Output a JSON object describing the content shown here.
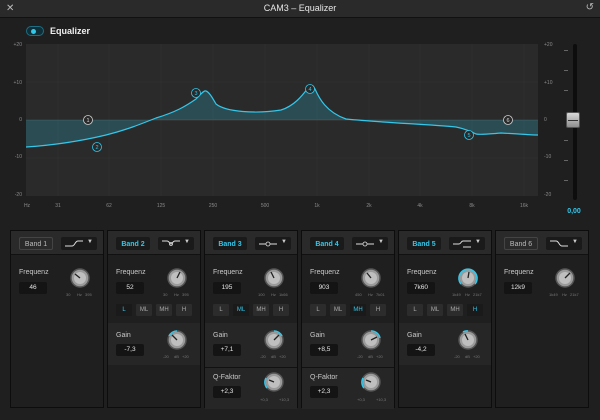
{
  "window": {
    "title": "CAM3 – Equalizer",
    "close_icon": "close-icon",
    "reset_icon": "reset-icon"
  },
  "equalizer": {
    "label": "Equalizer",
    "enabled": true,
    "accent": "#33c7ea"
  },
  "graph": {
    "y_ticks": [
      "+20",
      "+10",
      "0",
      "-10",
      "-20"
    ],
    "x_ticks": [
      "Hz",
      "31",
      "62",
      "125",
      "250",
      "500",
      "1k",
      "2k",
      "4k",
      "8k",
      "16k"
    ]
  },
  "output": {
    "gain_value": "0,00",
    "fader_ticks": [
      "",
      "",
      "",
      "",
      "",
      "",
      "",
      "",
      ""
    ]
  },
  "bands": [
    {
      "name": "Band 1",
      "active": false,
      "shape": "low-shelf",
      "frequency": {
        "label": "Frequenz",
        "value": "46",
        "min": "30",
        "mid": "Hz",
        "max": "395"
      }
    },
    {
      "name": "Band 2",
      "active": true,
      "shape": "bell-low",
      "frequency": {
        "label": "Frequenz",
        "value": "52",
        "min": "30",
        "mid": "Hz",
        "max": "395"
      },
      "ranges": [
        "L",
        "ML",
        "MH",
        "H"
      ],
      "selected_range": "L",
      "gain": {
        "label": "Gain",
        "value": "-7,3",
        "min": "-20",
        "mid": "dB",
        "max": "+20"
      }
    },
    {
      "name": "Band 3",
      "active": true,
      "shape": "bell",
      "frequency": {
        "label": "Frequenz",
        "value": "195",
        "min": "100",
        "mid": "Hz",
        "max": "1k66"
      },
      "ranges": [
        "L",
        "ML",
        "MH",
        "H"
      ],
      "selected_range": "ML",
      "gain": {
        "label": "Gain",
        "value": "+7,1",
        "min": "-20",
        "mid": "dB",
        "max": "+20"
      },
      "q": {
        "label": "Q-Faktor",
        "value": "+2,3",
        "min": "+0,3",
        "mid": "",
        "max": "+10,3"
      }
    },
    {
      "name": "Band 4",
      "active": true,
      "shape": "bell",
      "frequency": {
        "label": "Frequenz",
        "value": "903",
        "min": "450",
        "mid": "Hz",
        "max": "7k01"
      },
      "ranges": [
        "L",
        "ML",
        "MH",
        "H"
      ],
      "selected_range": "MH",
      "gain": {
        "label": "Gain",
        "value": "+8,5",
        "min": "-20",
        "mid": "dB",
        "max": "+20"
      },
      "q": {
        "label": "Q-Faktor",
        "value": "+2,3",
        "min": "+0,3",
        "mid": "",
        "max": "+10,3"
      }
    },
    {
      "name": "Band 5",
      "active": true,
      "shape": "bell-high",
      "frequency": {
        "label": "Frequenz",
        "value": "7k60",
        "min": "1k49",
        "mid": "Hz",
        "max": "21k7"
      },
      "ranges": [
        "L",
        "ML",
        "MH",
        "H"
      ],
      "selected_range": "H",
      "gain": {
        "label": "Gain",
        "value": "-4,2",
        "min": "-20",
        "mid": "dB",
        "max": "+20"
      }
    },
    {
      "name": "Band 6",
      "active": false,
      "shape": "high-shelf",
      "frequency": {
        "label": "Frequenz",
        "value": "12k9",
        "min": "1k49",
        "mid": "Hz",
        "max": "21k7"
      }
    }
  ]
}
